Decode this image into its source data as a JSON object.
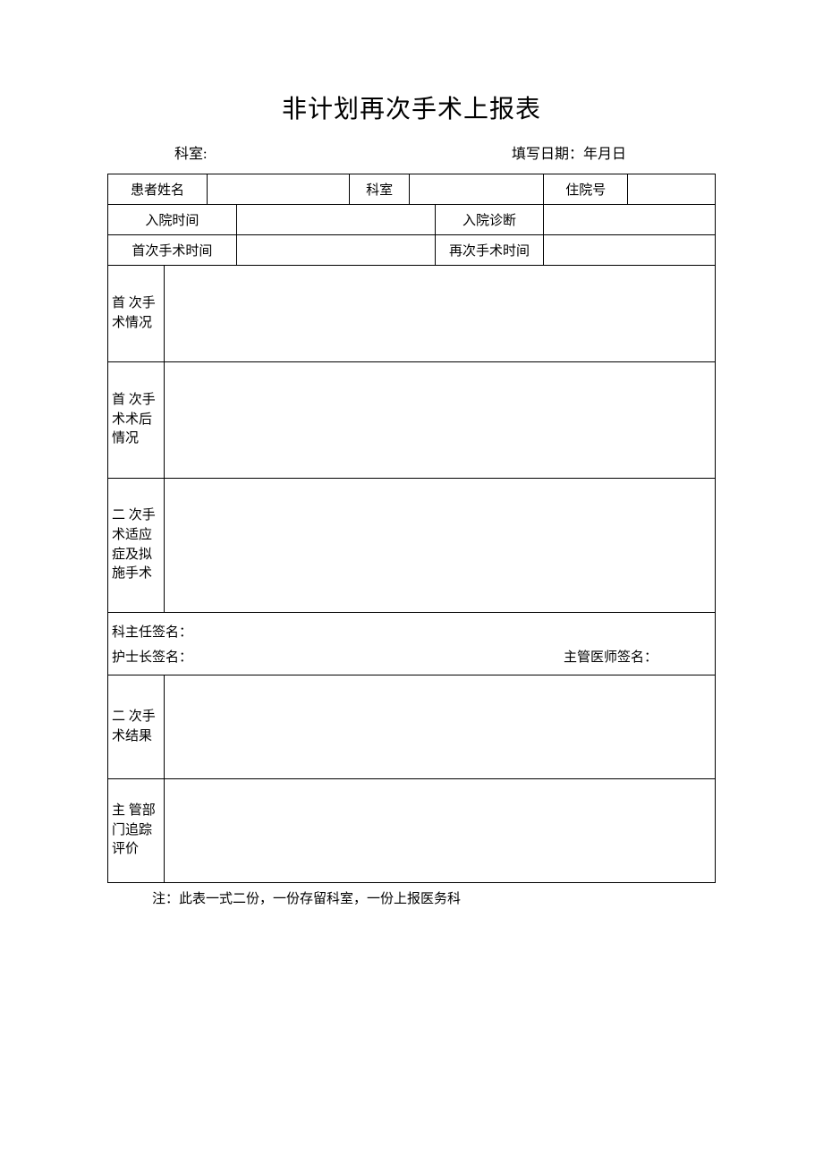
{
  "title": "非计划再次手术上报表",
  "header": {
    "dept_label": "科室:",
    "date_label": "填写日期：年月日"
  },
  "labels": {
    "patient_name": "患者姓名",
    "dept": "科室",
    "hosp_no": "住院号",
    "admit_time": "入院时间",
    "admit_diag": "入院诊断",
    "first_surgery_time": "首次手术时间",
    "re_surgery_time": "再次手术时间",
    "first_surgery_info": "首 次手术情况",
    "first_post_info": "首 次手术术后情况",
    "second_indication": "二 次手术适应症及拟施手术",
    "sig_chief": "科主任签名：",
    "sig_nurse": "护士长签名：",
    "sig_doctor": "主管医师签名：",
    "second_result": "二 次手术结果",
    "dept_followup": "主 管部门追踪评价"
  },
  "values": {
    "patient_name": "",
    "dept": "",
    "hosp_no": "",
    "admit_time": "",
    "admit_diag": "",
    "first_surgery_time": "",
    "re_surgery_time": "",
    "first_surgery_info": "",
    "first_post_info": "",
    "second_indication": "",
    "second_result": "",
    "dept_followup": ""
  },
  "footnote": "注：此表一式二份，一份存留科室，一份上报医务科"
}
